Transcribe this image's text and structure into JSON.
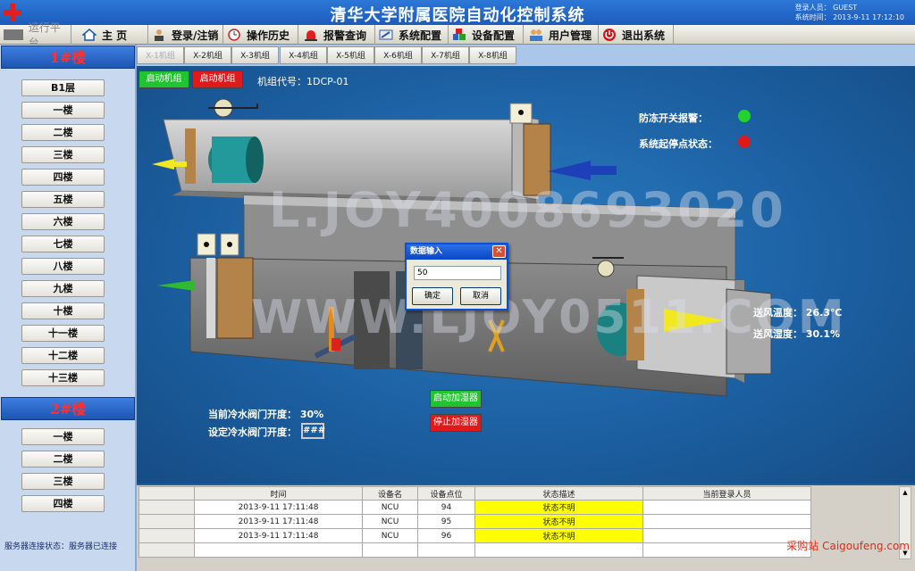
{
  "app": {
    "title": "清华大学附属医院自动化控制系统",
    "login_user": "登录人员： GUEST",
    "system_time": "系统时间： 2013-9-11  17:12:10"
  },
  "menu": {
    "items": [
      {
        "label": "运行平台",
        "icon": "monitor-icon"
      },
      {
        "label": "主 页",
        "icon": "home-icon"
      },
      {
        "label": "登录/注销",
        "icon": "user-login-icon"
      },
      {
        "label": "操作历史",
        "icon": "history-clock-icon"
      },
      {
        "label": "报警查询",
        "icon": "alarm-siren-icon"
      },
      {
        "label": "系统配置",
        "icon": "config-wrench-icon"
      },
      {
        "label": "设备配置",
        "icon": "equipment-blocks-icon"
      },
      {
        "label": "用户管理",
        "icon": "users-icon"
      },
      {
        "label": "退出系统",
        "icon": "power-icon"
      }
    ]
  },
  "sidebar": {
    "building1": "1#楼",
    "building1_floors": [
      "B1层",
      "一楼",
      "二楼",
      "三楼",
      "四楼",
      "五楼",
      "六楼",
      "七楼",
      "八楼",
      "九楼",
      "十楼",
      "十一楼",
      "十二楼",
      "十三楼"
    ],
    "building2": "2#楼",
    "building2_floors": [
      "一楼",
      "二楼",
      "三楼",
      "四楼"
    ],
    "server_status": "服务器连接状态：服务器已连接"
  },
  "unit_tabs": [
    "X-1机组",
    "X-2机组",
    "X-3机组",
    "X-4机组",
    "X-5机组",
    "X-6机组",
    "X-7机组",
    "X-8机组"
  ],
  "main": {
    "start_unit": "启动机组",
    "stop_unit": "启动机组",
    "unit_code": "机组代号：1DCP-01",
    "freeze_alarm": "防冻开关报警：",
    "start_stop_status": "系统起停点状态：",
    "supply_temp": "送风温度：  26.3℃",
    "supply_humidity": "送风湿度：  30.1%",
    "start_humidifier": "启动加湿器",
    "stop_humidifier": "停止加湿器",
    "current_valve": "当前冷水阀门开度：  30%",
    "set_valve": "设定冷水阀门开度：",
    "set_valve_value": "###",
    "colors": {
      "green_status": "#22d32a",
      "red_status": "#e01818"
    }
  },
  "dialog": {
    "title": "数据输入",
    "value": "50",
    "ok": "确定",
    "cancel": "取消"
  },
  "watermark": {
    "line1": "L.JOY4008693020",
    "line2": "WWW.LJOY0511.COM"
  },
  "log_table": {
    "headers": [
      "时间",
      "设备名",
      "设备点位",
      "状态描述",
      "当前登录人员"
    ],
    "rows": [
      [
        "2013-9-11 17:11:48",
        "NCU",
        "94",
        "状态不明",
        ""
      ],
      [
        "2013-9-11 17:11:48",
        "NCU",
        "95",
        "状态不明",
        ""
      ],
      [
        "2013-9-11 17:11:48",
        "NCU",
        "96",
        "状态不明",
        ""
      ]
    ]
  },
  "credit": "采购站 Caigoufeng.com"
}
